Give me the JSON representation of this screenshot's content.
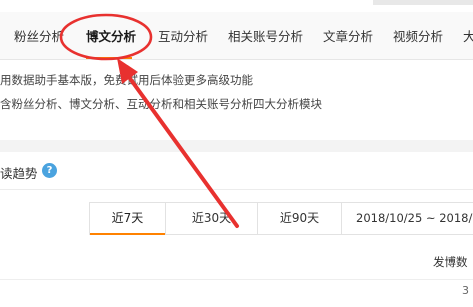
{
  "tabs": [
    {
      "label": "粉丝分析",
      "active": false
    },
    {
      "label": "博文分析",
      "active": true
    },
    {
      "label": "互动分析",
      "active": false
    },
    {
      "label": "相关账号分析",
      "active": false
    },
    {
      "label": "文章分析",
      "active": false
    },
    {
      "label": "视频分析",
      "active": false
    },
    {
      "label": "大",
      "active": false
    }
  ],
  "notice": {
    "line1": "用数据助手基本版，免费试用后体验更多高级功能",
    "line2": "含粉丝分析、博文分析、互动分析和相关账号分析四大分析模块"
  },
  "section": {
    "title": "读趋势",
    "help_icon": "?"
  },
  "range_selector": {
    "options": [
      "近7天",
      "近30天",
      "近90天"
    ],
    "active_index": 0,
    "date_range": "2018/10/25 ~ 2018/10/3"
  },
  "table": {
    "metric_label": "发博数"
  },
  "pagination": {
    "page": "3"
  },
  "colors": {
    "accent": "#ff8200",
    "annotation_red": "#e8312f",
    "help_icon_blue": "#4aa3df"
  },
  "icons": {
    "help": "question-circle-icon",
    "annotation": "red-arrow-annotation-icon"
  }
}
